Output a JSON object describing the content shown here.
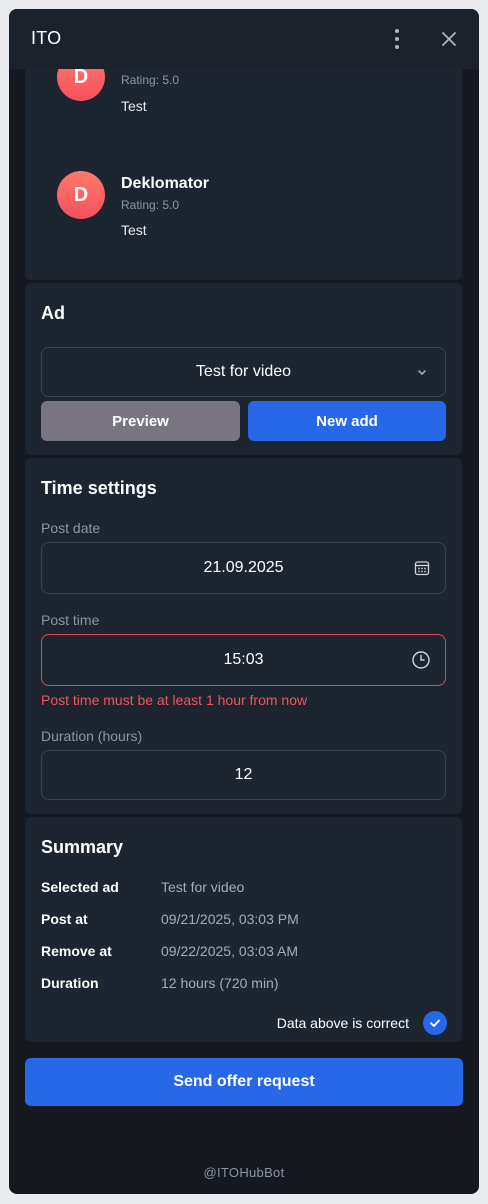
{
  "app": {
    "title": "ITO",
    "footer": "@ITOHubBot"
  },
  "reviews": [
    {
      "initial": "D",
      "name": "",
      "rating": "Rating: 5.0",
      "text": "Test"
    },
    {
      "initial": "D",
      "name": "Deklomator",
      "rating": "Rating: 5.0",
      "text": "Test"
    }
  ],
  "ad": {
    "title": "Ad",
    "selected": "Test for video",
    "preview_label": "Preview",
    "new_label": "New add"
  },
  "time": {
    "title": "Time settings",
    "post_date_label": "Post date",
    "post_date": "21.09.2025",
    "post_time_label": "Post time",
    "post_time": "15:03",
    "post_time_error": "Post time must be at least 1 hour from now",
    "duration_label": "Duration (hours)",
    "duration": "12"
  },
  "summary": {
    "title": "Summary",
    "rows": [
      {
        "key": "Selected ad",
        "value": "Test for video"
      },
      {
        "key": "Post at",
        "value": "09/21/2025, 03:03 PM"
      },
      {
        "key": "Remove at",
        "value": "09/22/2025, 03:03 AM"
      },
      {
        "key": "Duration",
        "value": "12 hours (720 min)"
      }
    ],
    "confirm_label": "Data above is correct",
    "confirmed": true
  },
  "send_label": "Send offer request",
  "colors": {
    "accent": "#2768e8",
    "error": "#f0545c",
    "avatar": "#f5505c"
  }
}
